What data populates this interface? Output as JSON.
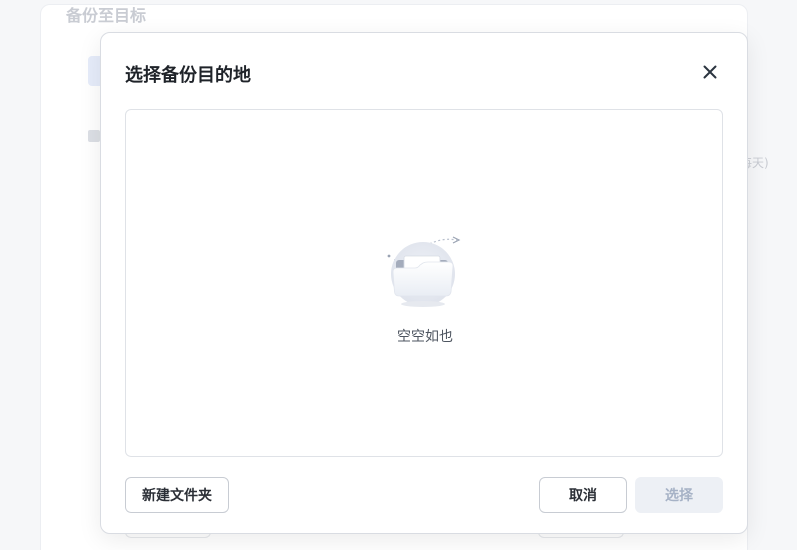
{
  "background": {
    "title": "备份至目标",
    "right_text": "每天)"
  },
  "dialog": {
    "title": "选择备份目的地",
    "close_icon": "close-icon",
    "empty": {
      "illustration": "empty-folder-icon",
      "text": "空空如也"
    },
    "buttons": {
      "new_folder": "新建文件夹",
      "cancel": "取消",
      "select": "选择"
    }
  },
  "colors": {
    "primary_disabled_bg": "#edf0f5",
    "primary_disabled_text": "#a6b2c6",
    "border": "#c8ccd3"
  }
}
